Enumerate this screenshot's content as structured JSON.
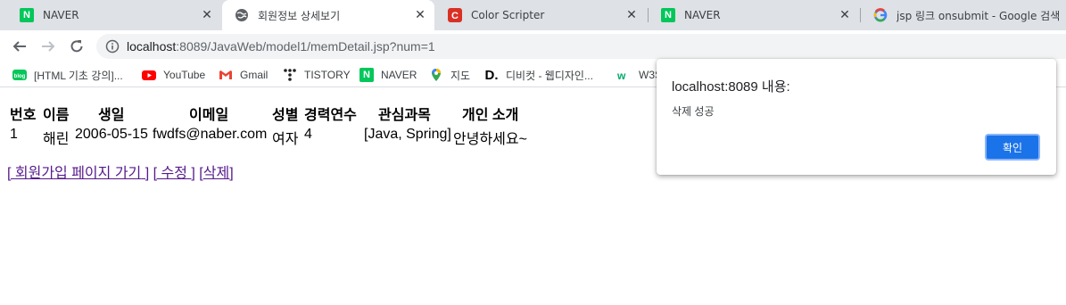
{
  "tabs": [
    {
      "title": "NAVER",
      "icon": "naver-icon"
    },
    {
      "title": "회원정보 상세보기",
      "icon": "globe-icon"
    },
    {
      "title": "Color Scripter",
      "icon": "color-scripter-icon"
    },
    {
      "title": "NAVER",
      "icon": "naver-icon"
    },
    {
      "title": "jsp 링크 onsubmit - Google 검색",
      "icon": "google-icon"
    }
  ],
  "address": {
    "host": "localhost",
    "rest": ":8089/JavaWeb/model1/memDetail.jsp?num=1"
  },
  "bookmarks": [
    {
      "label": "[HTML 기초 강의]...",
      "icon": "blog-icon"
    },
    {
      "label": "YouTube",
      "icon": "youtube-icon"
    },
    {
      "label": "Gmail",
      "icon": "gmail-icon"
    },
    {
      "label": "TISTORY",
      "icon": "tistory-icon"
    },
    {
      "label": "NAVER",
      "icon": "naver-icon"
    },
    {
      "label": "지도",
      "icon": "maps-icon"
    },
    {
      "label": "디비컷 - 웹디자인...",
      "icon": "dbcut-icon"
    },
    {
      "label": "W3S",
      "icon": "w3schools-icon"
    }
  ],
  "table": {
    "headers": [
      "번호",
      "이름",
      "생일",
      "이메일",
      "성별",
      "경력연수",
      "관심과목",
      "개인 소개"
    ],
    "row": [
      "1",
      "해린",
      "2006-05-15",
      "fwdfs@naber.com",
      "여자",
      "4",
      "[Java, Spring]",
      "안녕하세요~"
    ]
  },
  "links": {
    "join": "회원가입 페이지 가기",
    "edit": "수정",
    "delete": "삭제"
  },
  "dialog": {
    "title": "localhost:8089 내용:",
    "message": "삭제 성공",
    "ok": "확인"
  }
}
